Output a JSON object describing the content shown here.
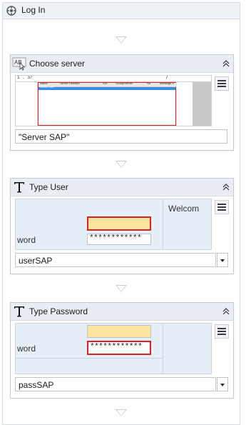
{
  "sequence": {
    "title": "Log In",
    "icon": "sequence-icon"
  },
  "activities": [
    {
      "title": "Choose server",
      "icon": "select-item-icon",
      "input_value": "\"Server SAP\"",
      "screenshot": {
        "toolbar_left": "1 . 3/",
        "toolbar_right": "7",
        "columns": [
          "Name",
          "Server Descript",
          "SID",
          "Group/Server",
          "Sa",
          "Message S"
        ],
        "selected_row": "Server SAP"
      }
    },
    {
      "title": "Type User",
      "icon": "type-into-icon",
      "input_value": "userSAP",
      "screenshot": {
        "label": "word",
        "masked": "************",
        "side_text": "Welcom"
      }
    },
    {
      "title": "Type Password",
      "icon": "type-into-icon",
      "input_value": "passSAP",
      "screenshot": {
        "label": "word",
        "masked": "************"
      }
    }
  ],
  "colors": {
    "highlight_border": "#e02020",
    "input_fill": "#fbe59e",
    "selection_blue": "#3c8be8"
  }
}
